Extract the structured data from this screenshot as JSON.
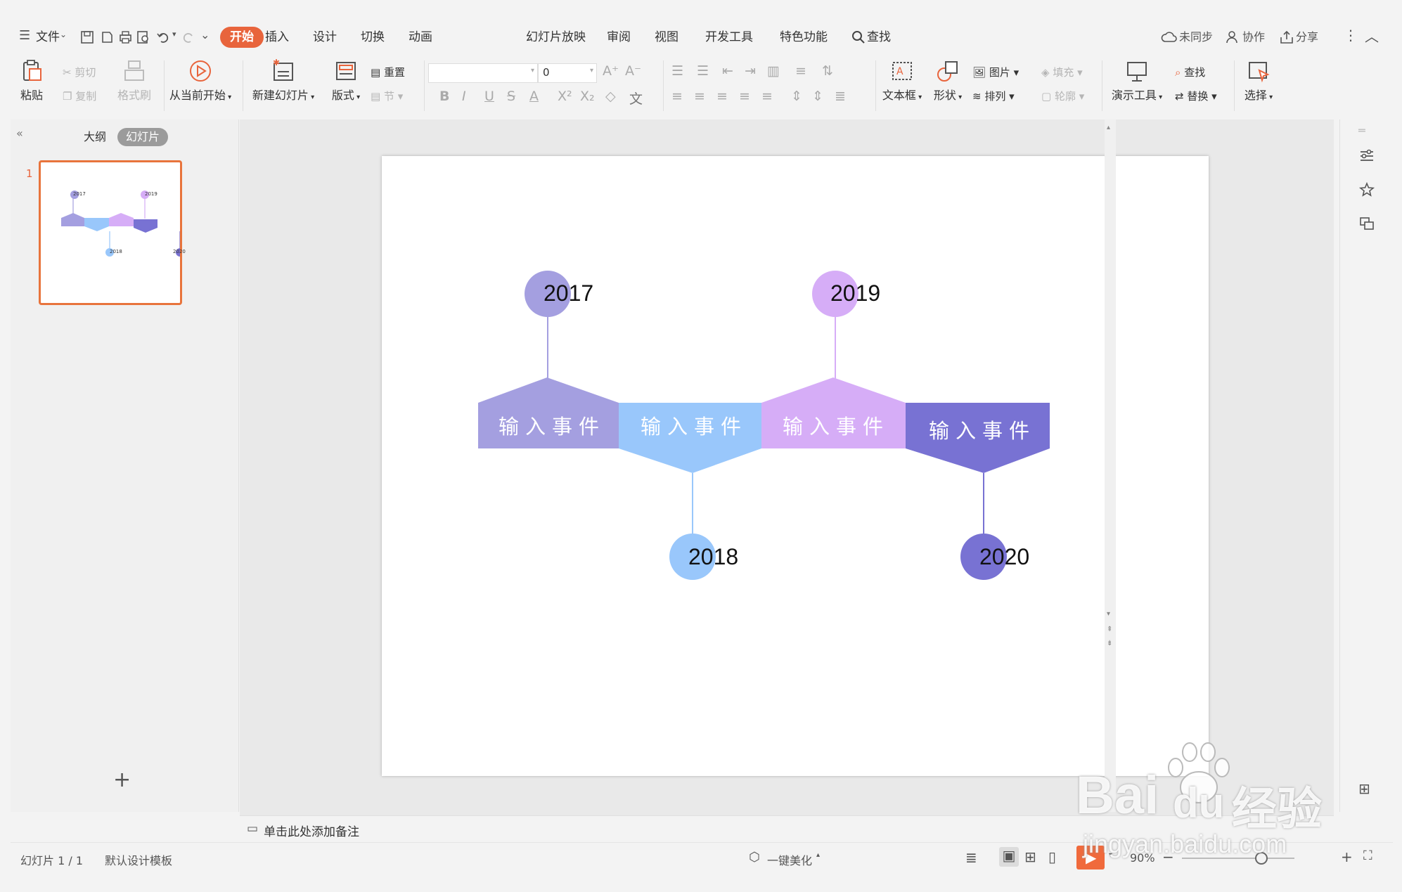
{
  "menubar": {
    "file_label": "文件",
    "tabs": [
      "开始",
      "插入",
      "设计",
      "切换",
      "动画",
      "幻灯片放映",
      "审阅",
      "视图",
      "开发工具",
      "特色功能"
    ],
    "search_label": "查找",
    "sync_label": "未同步",
    "collab_label": "协作",
    "share_label": "分享"
  },
  "ribbon": {
    "paste": "粘贴",
    "cut": "剪切",
    "copy": "复制",
    "format_painter": "格式刷",
    "from_current": "从当前开始",
    "new_slide": "新建幻灯片",
    "layout": "版式",
    "reset": "重置",
    "section": "节",
    "font_name": "",
    "font_size": "0",
    "textbox": "文本框",
    "shape": "形状",
    "picture": "图片",
    "fill": "填充",
    "arrange": "排列",
    "outline": "轮廓",
    "present_tools": "演示工具",
    "find": "查找",
    "replace": "替换",
    "select": "选择"
  },
  "left_panel": {
    "tab_outline": "大纲",
    "tab_slides": "幻灯片",
    "slide_number": "1",
    "add_label": "+"
  },
  "slide": {
    "events": [
      {
        "year": "2017",
        "label": "输入事件",
        "color": "#a49fe0"
      },
      {
        "year": "2018",
        "label": "输入事件",
        "color": "#99c7fb"
      },
      {
        "year": "2019",
        "label": "输入事件",
        "color": "#d6adf7"
      },
      {
        "year": "2020",
        "label": "输入事件",
        "color": "#7872d3"
      }
    ],
    "thumb_years": [
      "2017",
      "2018",
      "2019",
      "2020"
    ]
  },
  "notes": {
    "placeholder": "单击此处添加备注"
  },
  "statusbar": {
    "slide_info": "幻灯片 1 / 1",
    "template": "默认设计模板",
    "beautify": "一键美化",
    "zoom": "90%"
  },
  "watermark": {
    "brand": "Bai",
    "brand2": "du",
    "cn": "经验",
    "url": "jingyan.baidu.com"
  }
}
